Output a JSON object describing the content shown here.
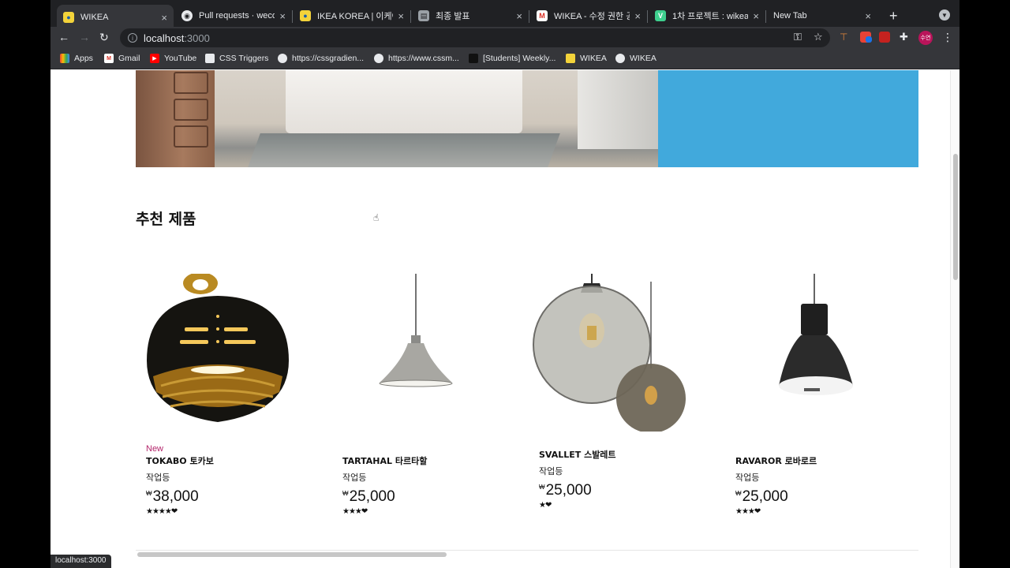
{
  "browser": {
    "tabs": [
      {
        "title": "WIKEA",
        "active": true,
        "icon": "ikea-icon"
      },
      {
        "title": "Pull requests · wecod",
        "active": false,
        "icon": "github-icon"
      },
      {
        "title": "IKEA KOREA | 이케아 코",
        "active": false,
        "icon": "ikea-icon"
      },
      {
        "title": "최종 발표",
        "active": false,
        "icon": "doc-icon"
      },
      {
        "title": "WIKEA - 수정 권한 공유",
        "active": false,
        "icon": "gmail-icon"
      },
      {
        "title": "1차 프로젝트 : wikea",
        "active": false,
        "icon": "v-icon"
      },
      {
        "title": "New Tab",
        "active": false,
        "icon": ""
      }
    ],
    "tab_close": "×",
    "new_tab": "+",
    "address": {
      "host": "localhost",
      "port": ":3000"
    },
    "profile_initials": "수연",
    "bookmarks": [
      {
        "label": "Apps",
        "icon": "apps-grid-icon"
      },
      {
        "label": "Gmail",
        "icon": "gmail-icon"
      },
      {
        "label": "YouTube",
        "icon": "youtube-icon"
      },
      {
        "label": "CSS Triggers",
        "icon": "css-triggers-icon"
      },
      {
        "label": "https://cssgradien...",
        "icon": "globe-icon"
      },
      {
        "label": "https://www.cssm...",
        "icon": "globe-icon"
      },
      {
        "label": "[Students] Weekly...",
        "icon": "notion-icon"
      },
      {
        "label": "WIKEA",
        "icon": "ikea-icon"
      },
      {
        "label": "WIKEA",
        "icon": "globe-icon"
      }
    ]
  },
  "page": {
    "section_title": "추천 제품",
    "products": [
      {
        "badge": "New",
        "name": "TOKABO 토카보",
        "category": "작업등",
        "currency": "₩",
        "price": "38,000",
        "rating": "★★★★❤"
      },
      {
        "badge": "",
        "name": "TARTAHAL 타르타할",
        "category": "작업등",
        "currency": "₩",
        "price": "25,000",
        "rating": "★★★❤"
      },
      {
        "badge": "",
        "name": "SVALLET 스발레트",
        "category": "작업등",
        "currency": "₩",
        "price": "25,000",
        "rating": "★❤"
      },
      {
        "badge": "",
        "name": "RAVAROR 로바로르",
        "category": "작업등",
        "currency": "₩",
        "price": "25,000",
        "rating": "★★★❤"
      }
    ],
    "carousel_scroll_fraction": 0.4
  },
  "status_bar": "localhost:3000",
  "colors": {
    "hero_blue": "#41a9dc",
    "new_badge": "#b3246a",
    "tab_bg": "#202124",
    "toolbar_bg": "#35363a"
  }
}
